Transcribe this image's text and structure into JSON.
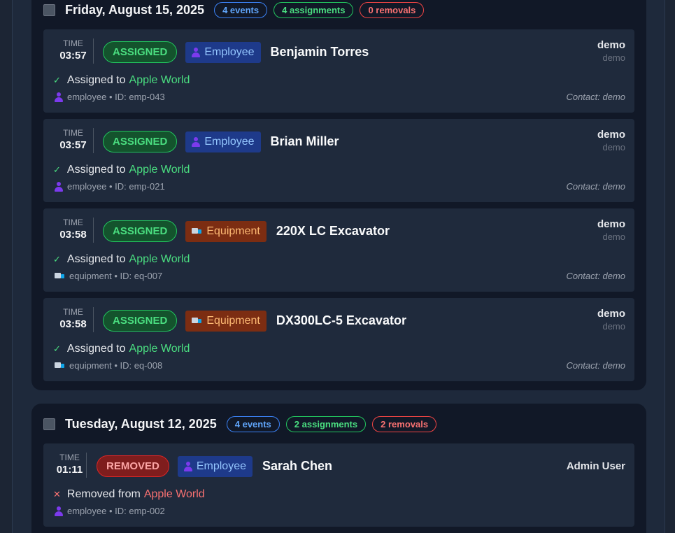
{
  "groups": [
    {
      "date": "Friday, August 15, 2025",
      "events": "4 events",
      "assignments": "4 assignments",
      "removals": "0 removals",
      "cards": [
        {
          "time_label": "TIME",
          "time": "03:57",
          "status": "ASSIGNED",
          "type": "Employee",
          "name": "Benjamin Torres",
          "user": "demo",
          "user_sub": "demo",
          "action": "Assigned to",
          "target": "Apple World",
          "meta": "employee • ID: emp-043",
          "contact": "Contact: demo"
        },
        {
          "time_label": "TIME",
          "time": "03:57",
          "status": "ASSIGNED",
          "type": "Employee",
          "name": "Brian Miller",
          "user": "demo",
          "user_sub": "demo",
          "action": "Assigned to",
          "target": "Apple World",
          "meta": "employee • ID: emp-021",
          "contact": "Contact: demo"
        },
        {
          "time_label": "TIME",
          "time": "03:58",
          "status": "ASSIGNED",
          "type": "Equipment",
          "name": "220X LC Excavator",
          "user": "demo",
          "user_sub": "demo",
          "action": "Assigned to",
          "target": "Apple World",
          "meta": "equipment • ID: eq-007",
          "contact": "Contact: demo"
        },
        {
          "time_label": "TIME",
          "time": "03:58",
          "status": "ASSIGNED",
          "type": "Equipment",
          "name": "DX300LC-5 Excavator",
          "user": "demo",
          "user_sub": "demo",
          "action": "Assigned to",
          "target": "Apple World",
          "meta": "equipment • ID: eq-008",
          "contact": "Contact: demo"
        }
      ]
    },
    {
      "date": "Tuesday, August 12, 2025",
      "events": "4 events",
      "assignments": "2 assignments",
      "removals": "2 removals",
      "cards": [
        {
          "time_label": "TIME",
          "time": "01:11",
          "status": "REMOVED",
          "type": "Employee",
          "name": "Sarah Chen",
          "user": "Admin User",
          "action": "Removed from",
          "target": "Apple World",
          "meta": "employee • ID: emp-002"
        }
      ]
    }
  ],
  "colors": {
    "assigned": "#4ade80",
    "removed": "#f87171",
    "events": "#60a5fa"
  },
  "icons": {
    "employee": "person-icon",
    "equipment": "truck-icon",
    "assigned": "check-icon",
    "removed": "x-icon"
  }
}
